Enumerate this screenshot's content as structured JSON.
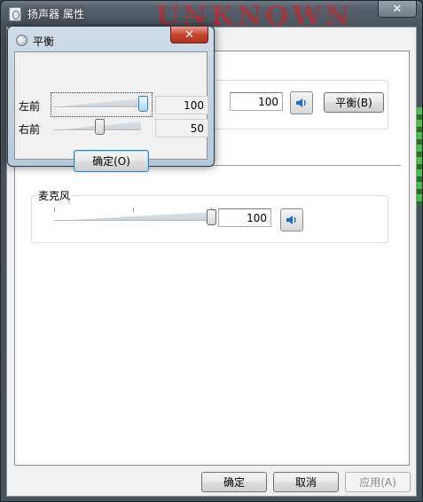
{
  "main": {
    "title": "扬声器 属性",
    "close_glyph": "✕",
    "groups": {
      "speakers": {
        "value": "100",
        "balance_label": "平衡(B)",
        "slider_fraction": 1.0
      },
      "microphone": {
        "label": "麦克风",
        "value": "100",
        "slider_fraction": 1.0
      }
    },
    "buttons": {
      "ok": "确定",
      "cancel": "取消",
      "apply": "应用(A)"
    }
  },
  "balance": {
    "title": "平衡",
    "close_glyph": "✕",
    "channels": [
      {
        "label": "左前",
        "value": "100",
        "fraction": 1.0
      },
      {
        "label": "右前",
        "value": "50",
        "fraction": 0.5
      }
    ],
    "ok_label": "确定(O)"
  },
  "colors": {
    "accent": "#3c7fb1",
    "close_red": "#c7442d",
    "speaker_blue": "#1e6fc8"
  },
  "icons": {
    "speaker": "speaker-icon",
    "window": "window-icon",
    "balance": "balance-icon",
    "close": "close-icon"
  }
}
